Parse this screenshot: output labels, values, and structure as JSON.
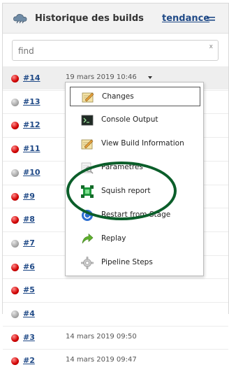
{
  "header": {
    "title": "Historique des builds",
    "trend_link": "tendance",
    "icon": "cloud-icon",
    "trend_icon": "trend-lines-icon"
  },
  "search": {
    "placeholder": "find",
    "clear": "x"
  },
  "builds": [
    {
      "number": "#14",
      "status": "red",
      "date": "19 mars 2019 10:46"
    },
    {
      "number": "#13",
      "status": "grey",
      "date": ""
    },
    {
      "number": "#12",
      "status": "red",
      "date": ""
    },
    {
      "number": "#11",
      "status": "red",
      "date": ""
    },
    {
      "number": "#10",
      "status": "grey",
      "date": ""
    },
    {
      "number": "#9",
      "status": "red",
      "date": ""
    },
    {
      "number": "#8",
      "status": "red",
      "date": ""
    },
    {
      "number": "#7",
      "status": "grey",
      "date": ""
    },
    {
      "number": "#6",
      "status": "red",
      "date": ""
    },
    {
      "number": "#5",
      "status": "red",
      "date": ""
    },
    {
      "number": "#4",
      "status": "grey",
      "date": ""
    },
    {
      "number": "#3",
      "status": "red",
      "date": "14 mars 2019 09:50"
    },
    {
      "number": "#2",
      "status": "red",
      "date": "14 mars 2019 09:47"
    }
  ],
  "menu": {
    "items": [
      {
        "label": "Changes",
        "icon": "notepad-pencil-icon"
      },
      {
        "label": "Console Output",
        "icon": "terminal-icon"
      },
      {
        "label": "View Build Information",
        "icon": "notepad-pencil-icon"
      },
      {
        "label": "Paramètres",
        "icon": "notepad-magnifier-icon"
      },
      {
        "label": "Squish report",
        "icon": "squish-icon"
      },
      {
        "label": "Restart from Stage",
        "icon": "restart-icon"
      },
      {
        "label": "Replay",
        "icon": "replay-arrow-icon"
      },
      {
        "label": "Pipeline Steps",
        "icon": "gear-icon"
      }
    ]
  },
  "colors": {
    "link": "#204a87",
    "status_red": "#d00000",
    "status_grey": "#a8a8a8",
    "annotation": "#0b5e2a"
  }
}
